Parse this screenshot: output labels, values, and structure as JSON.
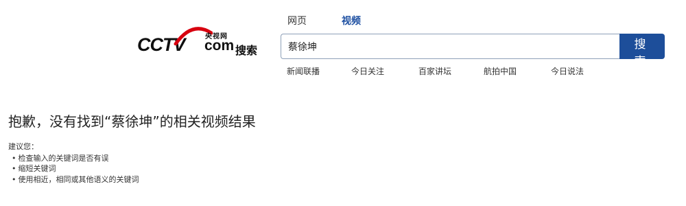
{
  "logo": {
    "wordmark": "CCTV",
    "domain": "com",
    "channel": "央视网",
    "product": "搜索"
  },
  "tabs": [
    {
      "label": "网页",
      "active": false
    },
    {
      "label": "视频",
      "active": true
    }
  ],
  "search": {
    "query": "蔡徐坤",
    "button_label": "搜 索"
  },
  "quick_links": [
    "新闻联播",
    "今日关注",
    "百家讲坛",
    "航拍中国",
    "今日说法"
  ],
  "result": {
    "message": "抱歉，没有找到“蔡徐坤”的相关视频结果",
    "suggest_title": "建议您：",
    "suggestions": [
      "检查输入的关键词是否有误",
      "缩短关键词",
      "使用相近，相同或其他语义的关键词"
    ]
  },
  "colors": {
    "accent": "#1d4e9a",
    "logo_red": "#d7000f"
  }
}
